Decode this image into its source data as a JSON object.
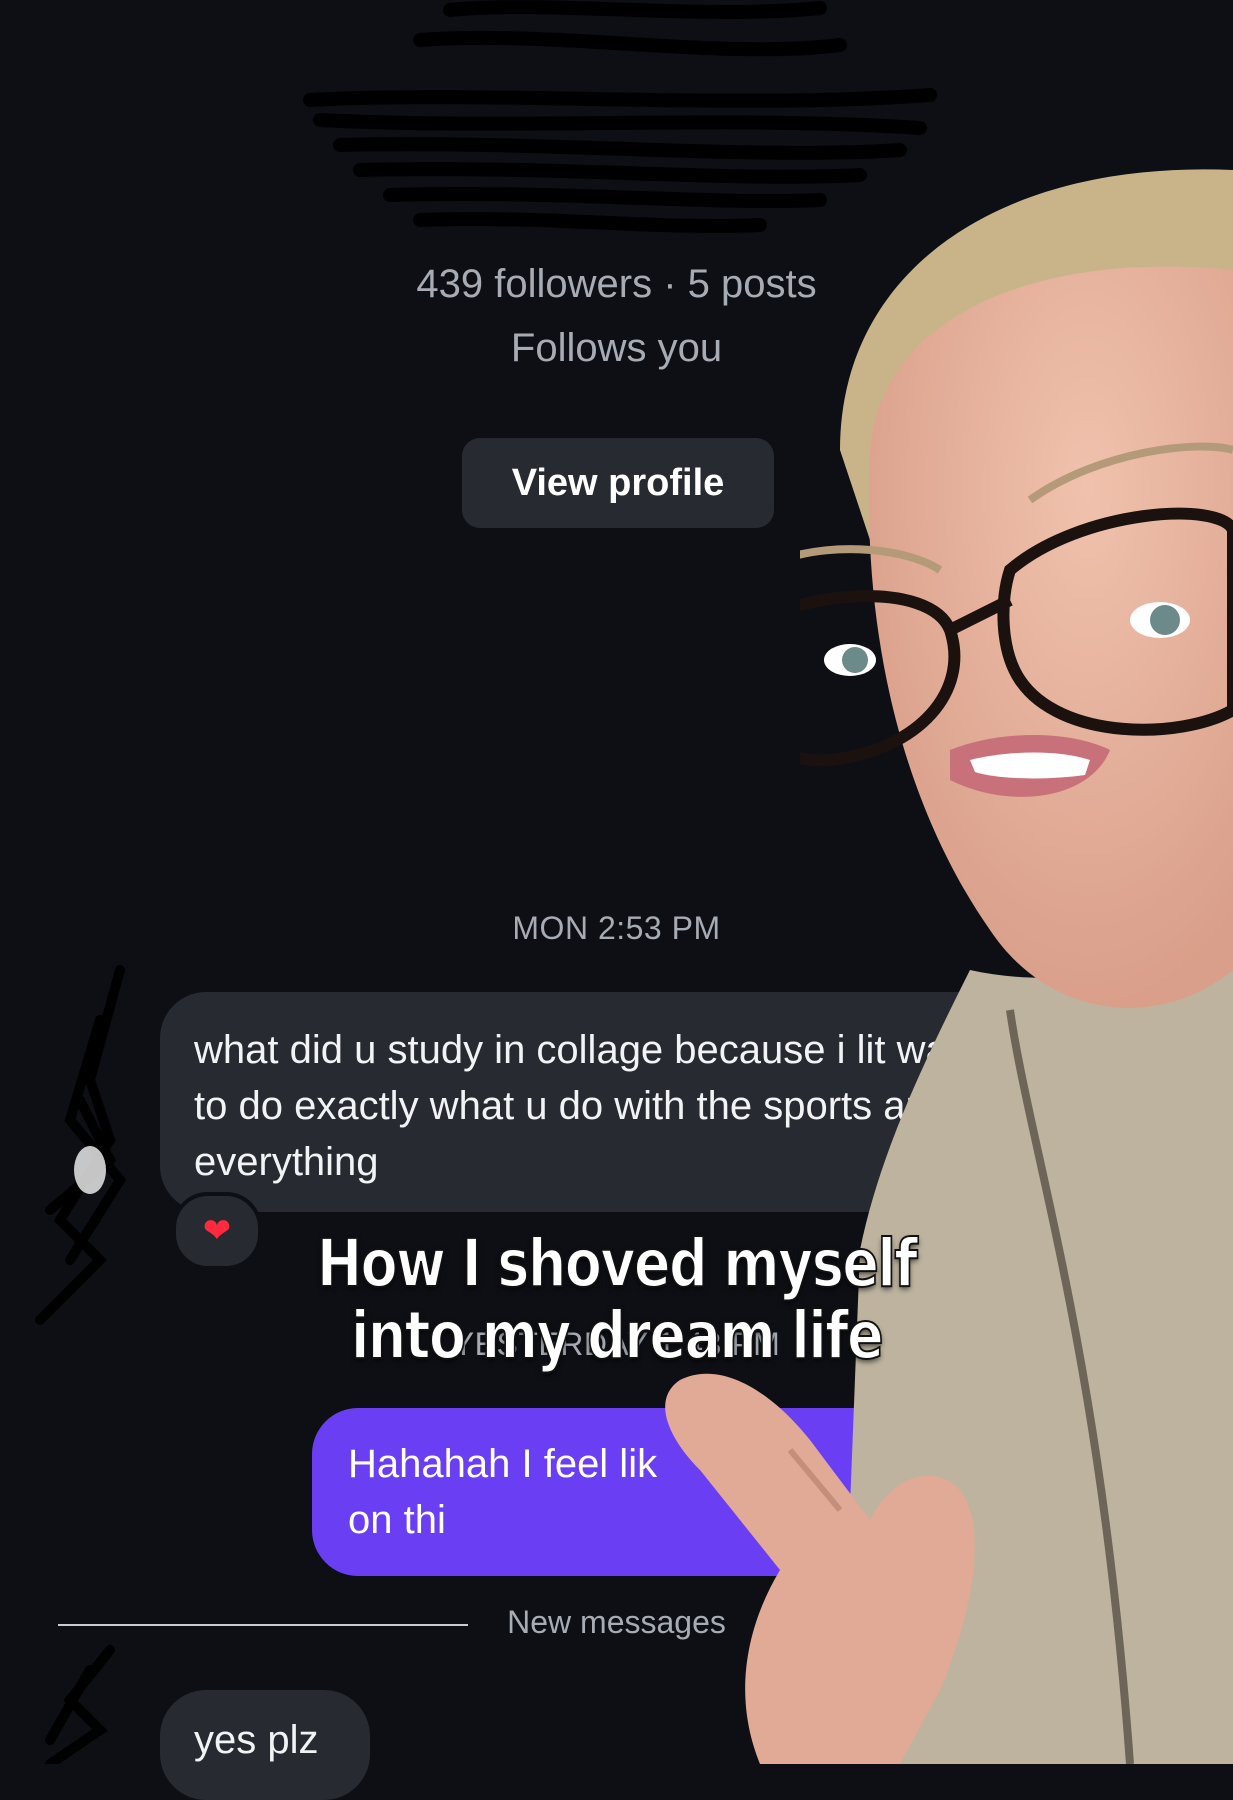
{
  "profile": {
    "stats": "439 followers · 5 posts",
    "follows_you": "Follows you",
    "view_profile_label": "View profile"
  },
  "thread": {
    "timestamp_1": "MON 2:53 PM",
    "message_1": "what did u study in collage because i lit want to do exactly what u do with the sports and everything",
    "reaction_1": "❤",
    "timestamp_2": "YESTERDAY 1:43 PM",
    "message_2": "Hahahah I feel lik",
    "message_2_line2": "on thi",
    "divider_label": "New messages",
    "message_3": "yes plz"
  },
  "overlay": {
    "caption_line1": "How I shoved myself",
    "caption_line2": "into my dream life"
  },
  "colors": {
    "background": "#0d0f15",
    "incoming_bubble": "#272a31",
    "outgoing_bubble": "#6a3ef2",
    "reaction_heart": "#ff2a3d"
  }
}
